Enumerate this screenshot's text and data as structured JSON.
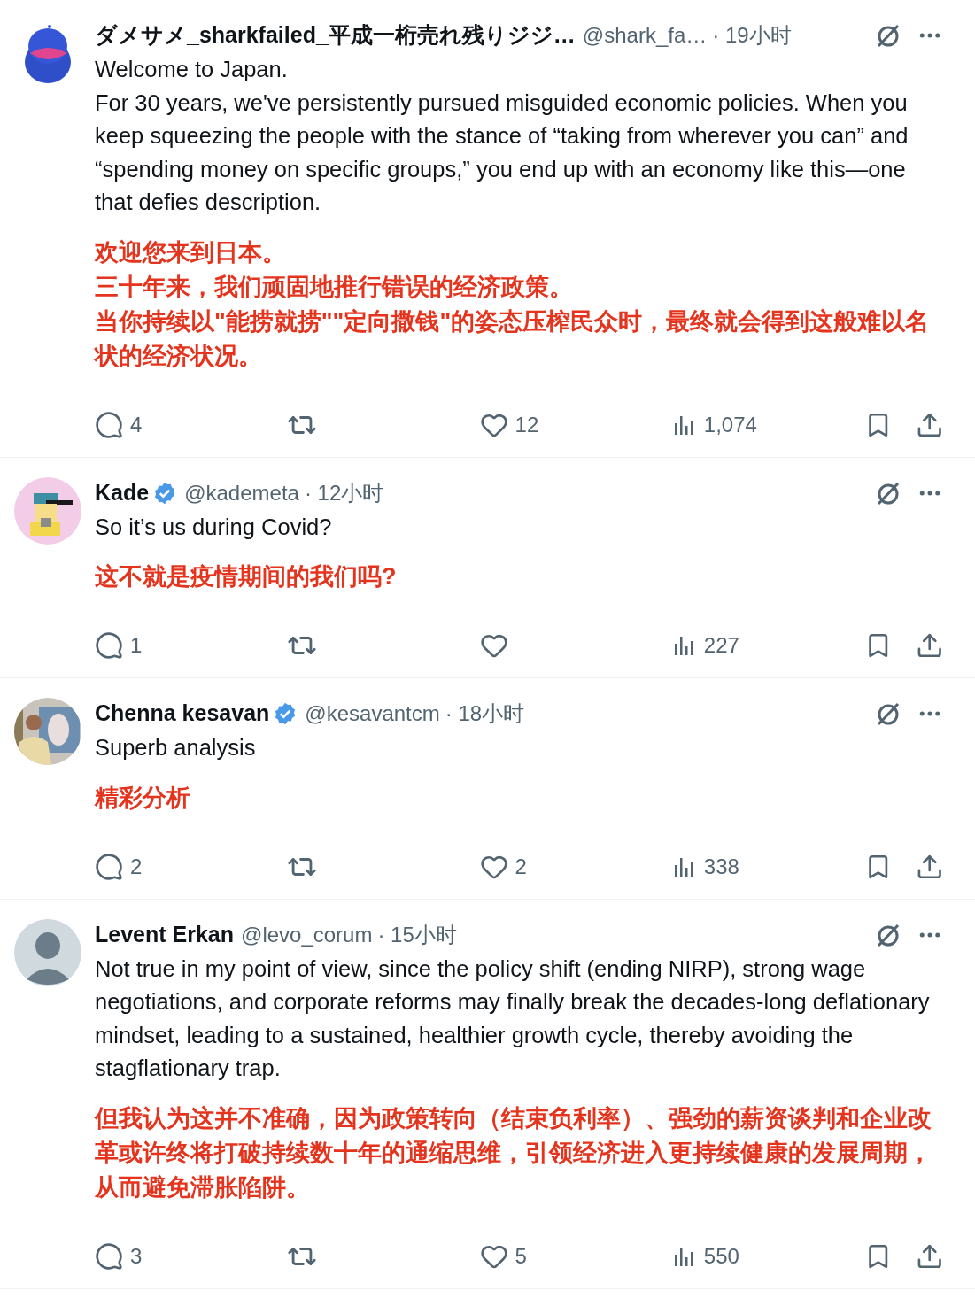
{
  "posts": [
    {
      "avatar": {
        "kind": "blob"
      },
      "name": "ダメサメ_sharkfailed_平成一桁売れ残りジジ…",
      "verified": false,
      "handle": "@shark_fa…",
      "time": "· 19小时",
      "text": [
        "Welcome to Japan.",
        "For 30 years, we've persistently pursued misguided economic policies. When you keep squeezing the people with the stance of “taking from wherever you can” and “spending money on specific groups,” you end up with an economy like this—one that defies description."
      ],
      "translation": [
        "欢迎您来到日本。",
        "三十年来，我们顽固地推行错误的经济政策。",
        "当你持续以\"能捞就捞\"\"定向撒钱\"的姿态压榨民众时，最终就会得到这般难以名状的经济状况。"
      ],
      "replies": "4",
      "likes": "12",
      "views": "1,074"
    },
    {
      "avatar": {
        "kind": "pixel"
      },
      "name": "Kade",
      "verified": true,
      "handle": "@kademeta",
      "time": "· 12小时",
      "text": [
        "So it’s us during Covid?"
      ],
      "translation": [
        "这不就是疫情期间的我们吗?"
      ],
      "replies": "1",
      "views": "227"
    },
    {
      "avatar": {
        "kind": "picture"
      },
      "name": "Chenna kesavan",
      "verified": true,
      "handle": "@kesavantcm",
      "time": "· 18小时",
      "text": [
        "Superb analysis"
      ],
      "translation": [
        "精彩分析"
      ],
      "replies": "2",
      "likes": "2",
      "views": "338"
    },
    {
      "avatar": {
        "kind": "default"
      },
      "name": "Levent Erkan",
      "verified": false,
      "handle": "@levo_corum",
      "time": "· 15小时",
      "text": [
        "Not true in my point of view, since the policy shift (ending NIRP), strong wage negotiations, and corporate reforms may finally break the decades-long deflationary mindset, leading to a sustained, healthier growth cycle, thereby avoiding the stagflationary trap."
      ],
      "translation": [
        "但我认为这并不准确，因为政策转向（结束负利率）、强劲的薪资谈判和企业改革或许终将打破持续数十年的通缩思维，引领经济进入更持续健康的发展周期，从而避免滞胀陷阱。"
      ],
      "replies": "3",
      "likes": "5",
      "views": "550"
    }
  ]
}
